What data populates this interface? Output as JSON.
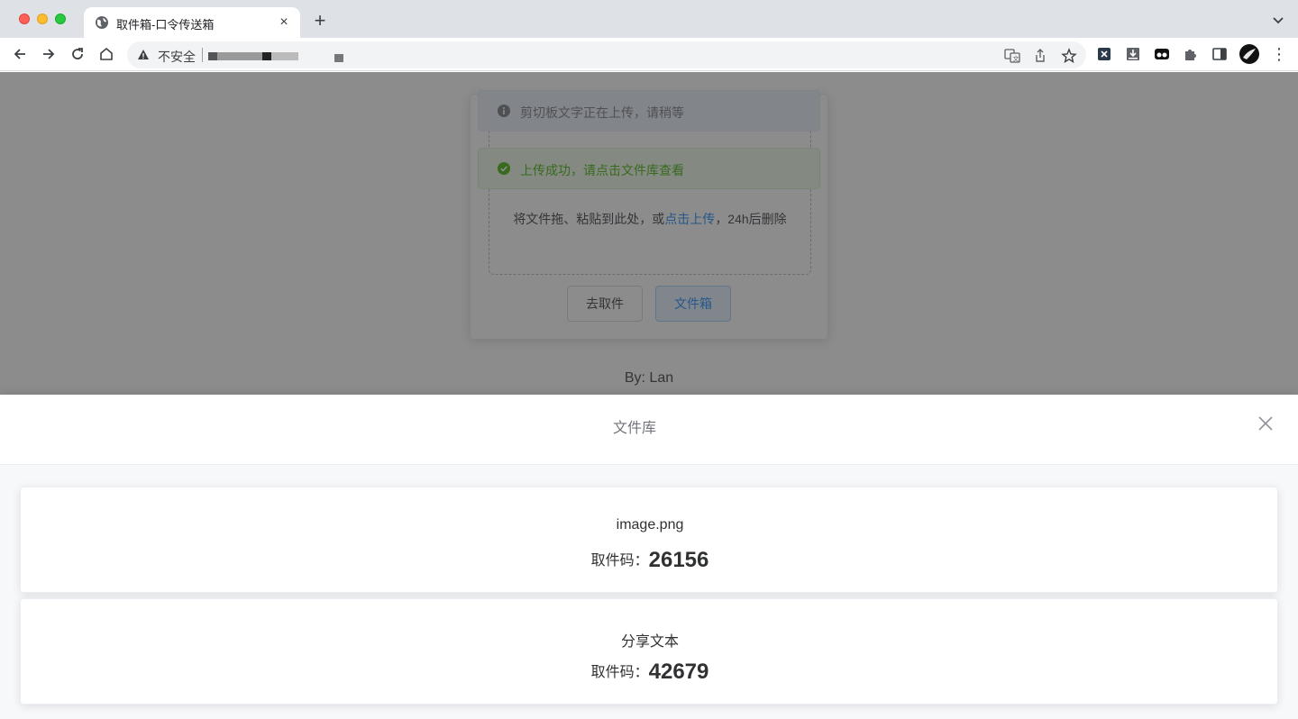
{
  "browser": {
    "tab_title": "取件箱-口令传送箱",
    "new_tab": "+",
    "tab_close": "×",
    "security_label": "不安全",
    "menu": "⋮"
  },
  "upload_card": {
    "dropzone_prefix": "将文件拖、粘贴到此处，或",
    "dropzone_link": "点击上传",
    "dropzone_suffix": "，24h后删除",
    "button_get": "去取件",
    "button_box": "文件箱"
  },
  "byline": "By: Lan",
  "toasts": {
    "info": "剪切板文字正在上传，请稍等",
    "success": "上传成功，请点击文件库查看"
  },
  "drawer": {
    "title": "文件库",
    "code_label": "取件码：",
    "files": [
      {
        "name": "image.png",
        "code": "26156"
      },
      {
        "name": "分享文本",
        "code": "42679"
      }
    ]
  },
  "colors": {
    "link": "#409eff",
    "success": "#67c23a",
    "info": "#909399"
  }
}
